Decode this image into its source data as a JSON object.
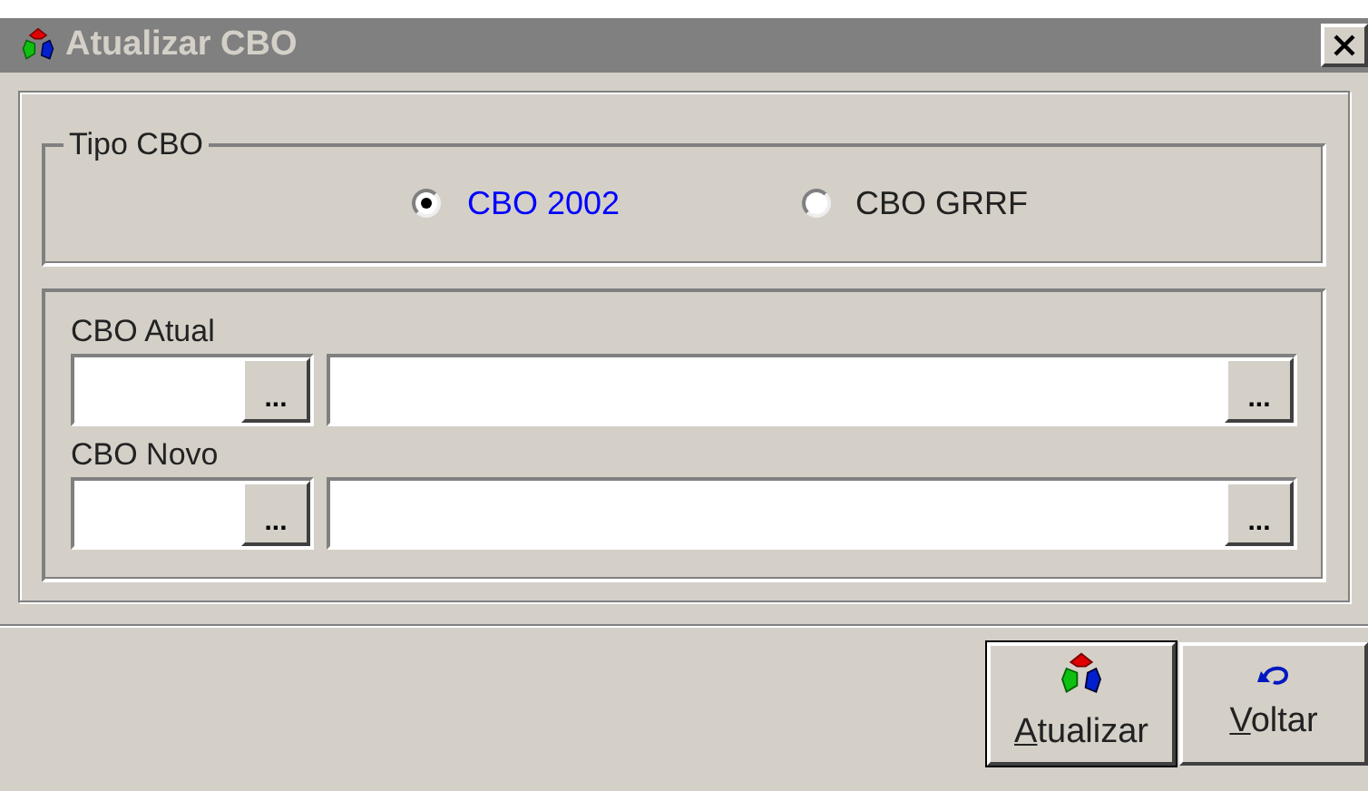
{
  "window": {
    "title": "Atualizar CBO"
  },
  "tipo_cbo": {
    "legend": "Tipo CBO",
    "options": [
      {
        "label": "CBO 2002",
        "selected": true
      },
      {
        "label": "CBO GRRF",
        "selected": false
      }
    ]
  },
  "fields": [
    {
      "label": "CBO Atual",
      "code_button": "...",
      "description_button": "..."
    },
    {
      "label": "CBO Novo",
      "code_button": "...",
      "description_button": "..."
    }
  ],
  "buttons": [
    {
      "label": "Atualizar",
      "kind": "update",
      "default": true
    },
    {
      "label": "Voltar",
      "kind": "back",
      "default": false
    }
  ]
}
